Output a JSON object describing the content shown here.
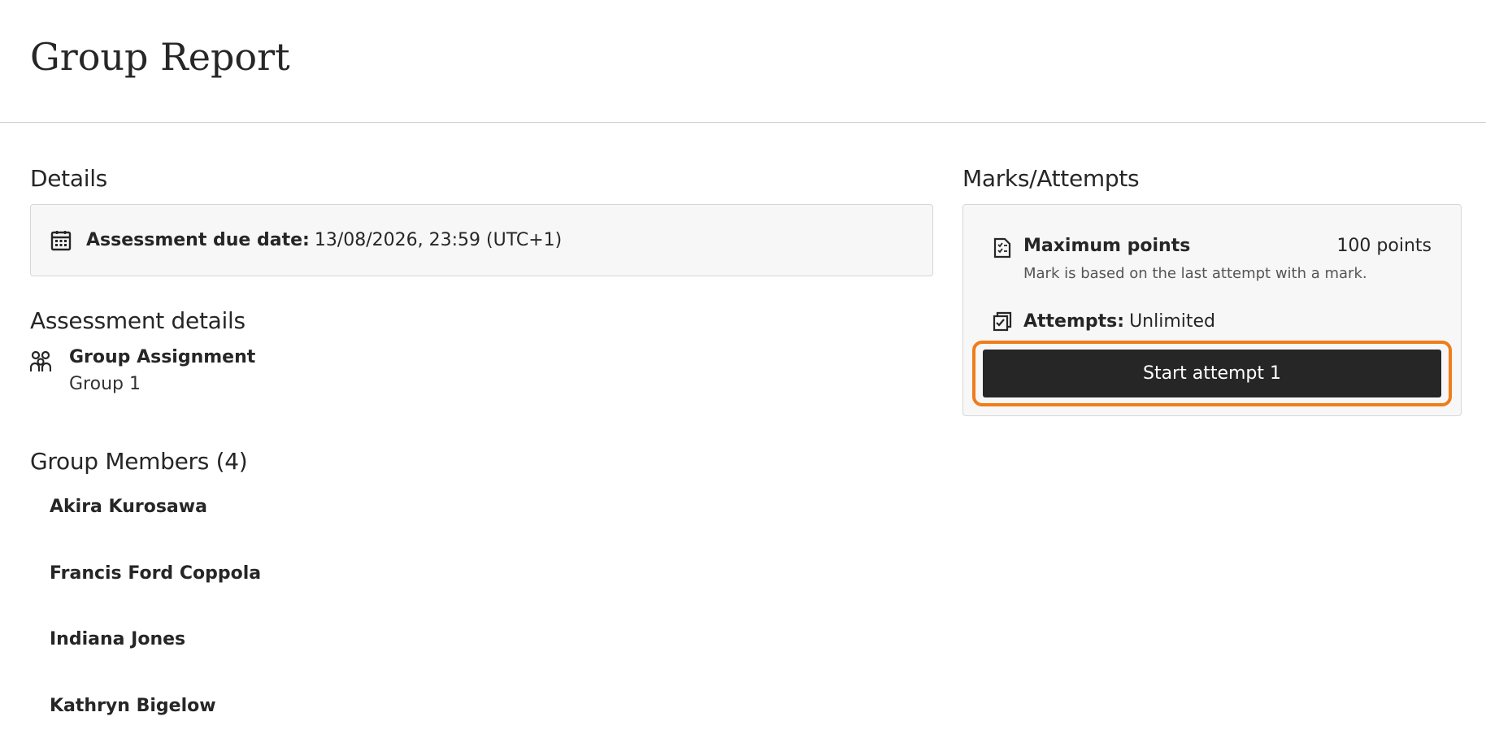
{
  "header": {
    "title": "Group Report"
  },
  "details": {
    "title": "Details",
    "due_label": "Assessment due date:",
    "due_value": "13/08/2026, 23:59 (UTC+1)"
  },
  "assessment_details": {
    "title": "Assessment details",
    "type": "Group Assignment",
    "group": "Group 1"
  },
  "group_members": {
    "title": "Group Members (4)",
    "members": [
      "Akira Kurosawa",
      "Francis Ford Coppola",
      "Indiana Jones",
      "Kathryn Bigelow"
    ]
  },
  "marks": {
    "title": "Marks/Attempts",
    "max_points_label": "Maximum points",
    "max_points_value": "100 points",
    "max_points_note": "Mark is based on the last attempt with a mark.",
    "attempts_label": "Attempts:",
    "attempts_value": "Unlimited",
    "start_button": "Start attempt 1"
  },
  "colors": {
    "button_bg": "#262626",
    "highlight": "#f07c1a",
    "box_bg": "#f7f7f7"
  },
  "icons": [
    "calendar-icon",
    "group-icon",
    "points-icon",
    "attempts-icon"
  ]
}
